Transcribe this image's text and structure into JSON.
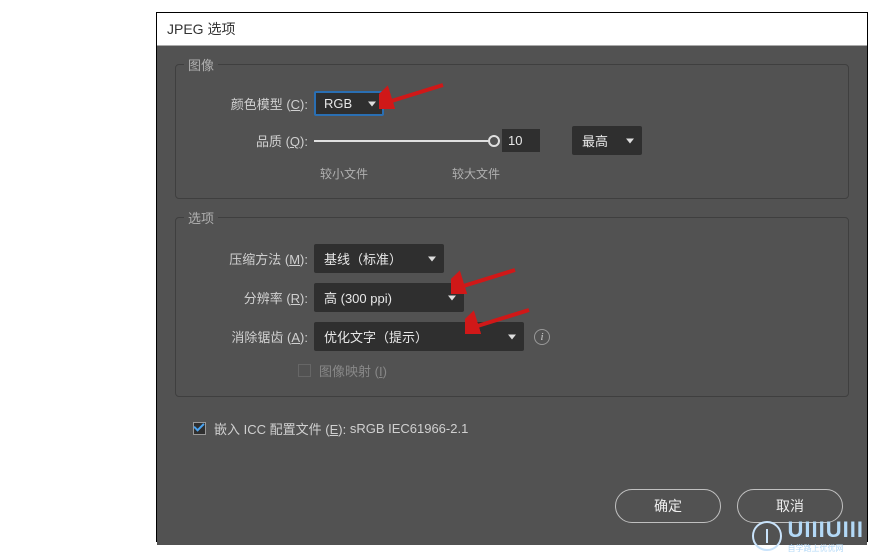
{
  "dialog": {
    "title": "JPEG 选项"
  },
  "groups": {
    "image": {
      "title": "图像",
      "colorModel": {
        "label": "颜色模型 (",
        "hotkey": "C",
        "suffix": "):",
        "value": "RGB"
      },
      "quality": {
        "label": "品质 (",
        "hotkey": "Q",
        "suffix": "):",
        "value": "10",
        "presetValue": "最高",
        "minLabel": "较小文件",
        "maxLabel": "较大文件"
      }
    },
    "options": {
      "title": "选项",
      "compression": {
        "label": "压缩方法 (",
        "hotkey": "M",
        "suffix": "):",
        "value": "基线（标准）"
      },
      "resolution": {
        "label": "分辨率 (",
        "hotkey": "R",
        "suffix": "):",
        "value": "高 (300 ppi)"
      },
      "antialias": {
        "label": "消除锯齿 (",
        "hotkey": "A",
        "suffix": "):",
        "value": "优化文字（提示）"
      },
      "imagemap": {
        "label": "图像映射 (",
        "hotkey": "I",
        "suffix": ")"
      }
    }
  },
  "embed": {
    "label": "嵌入 ICC 配置文件 (",
    "hotkey": "E",
    "suffix": "):",
    "profile": "sRGB IEC61966-2.1"
  },
  "buttons": {
    "ok": "确定",
    "cancel": "取消"
  },
  "branding": {
    "name": "UIIIUIII",
    "tagline": "自学路上优优网"
  }
}
